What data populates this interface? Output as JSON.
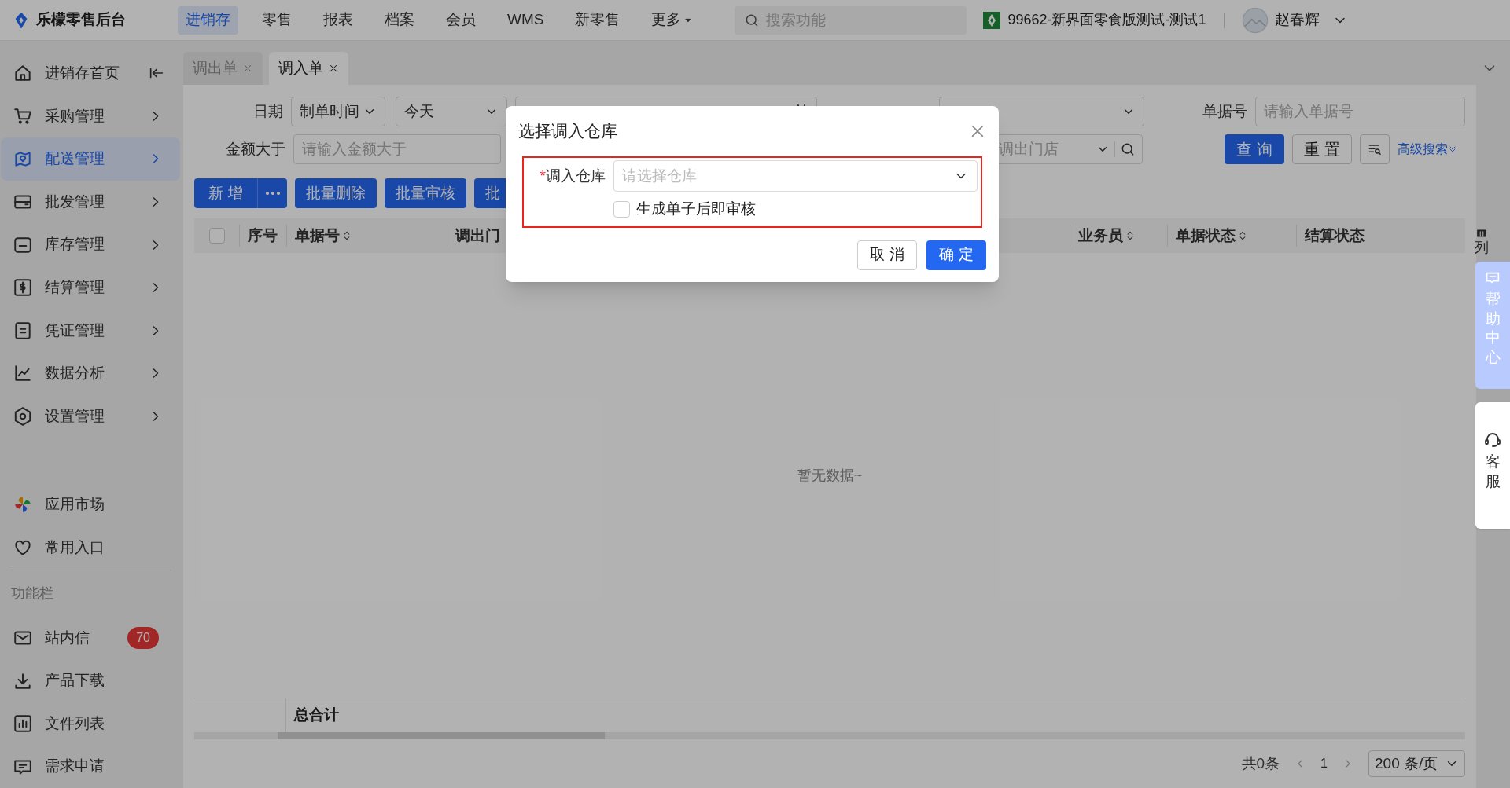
{
  "header": {
    "logo": "乐檬零售后台",
    "nav": [
      {
        "label": "进销存",
        "selected": true
      },
      {
        "label": "零售",
        "selected": false
      },
      {
        "label": "报表",
        "selected": false
      },
      {
        "label": "档案",
        "selected": false
      },
      {
        "label": "会员",
        "selected": false
      },
      {
        "label": "WMS",
        "selected": false
      },
      {
        "label": "新零售",
        "selected": false
      },
      {
        "label": "更多",
        "selected": false,
        "kind": "dropdown"
      }
    ],
    "search": {
      "placeholder": "搜索功能"
    },
    "store": "99662-新界面零食版测试-测试1",
    "user": "赵春辉"
  },
  "sidebar": {
    "items": [
      {
        "label": "进销存首页",
        "selected": false,
        "kind": "collapse"
      },
      {
        "label": "采购管理",
        "selected": false,
        "kind": "menu"
      },
      {
        "label": "配送管理",
        "selected": true,
        "kind": "menu"
      },
      {
        "label": "批发管理",
        "selected": false,
        "kind": "menu"
      },
      {
        "label": "库存管理",
        "selected": false,
        "kind": "menu"
      },
      {
        "label": "结算管理",
        "selected": false,
        "kind": "menu"
      },
      {
        "label": "凭证管理",
        "selected": false,
        "kind": "menu"
      },
      {
        "label": "数据分析",
        "selected": false,
        "kind": "menu"
      },
      {
        "label": "设置管理",
        "selected": false,
        "kind": "menu"
      }
    ],
    "extras": [
      {
        "label": "应用市场"
      },
      {
        "label": "常用入口"
      }
    ],
    "section_title": "功能栏",
    "tools": [
      {
        "label": "站内信",
        "badge": "70"
      },
      {
        "label": "产品下载"
      },
      {
        "label": "文件列表"
      },
      {
        "label": "需求申请"
      }
    ]
  },
  "tabs": [
    {
      "label": "调出单",
      "selected": false
    },
    {
      "label": "调入单",
      "selected": true
    }
  ],
  "filters": {
    "date_label": "日期",
    "date_type": "制单时间",
    "date_range": "今天",
    "doc_no_label": "单据号",
    "doc_no_placeholder": "请输入单据号",
    "amount_label": "金额大于",
    "amount_placeholder": "请输入金额大于",
    "store_placeholder": "调出门店",
    "query": "查 询",
    "reset": "重 置",
    "advanced": "高级搜索"
  },
  "actions": [
    "新 增",
    "批量删除",
    "批量审核",
    "批"
  ],
  "table": {
    "columns": [
      {
        "label": "序号",
        "sortable": false
      },
      {
        "label": "单据号",
        "sortable": true
      },
      {
        "label": "调出门",
        "sortable": false
      },
      {
        "label": "业务员",
        "sortable": true
      },
      {
        "label": "单据状态",
        "sortable": true
      },
      {
        "label": "结算状态",
        "sortable": false
      }
    ],
    "select_all_checked": false,
    "column_settings": "列",
    "empty": "暂无数据~",
    "total_label": "总合计"
  },
  "pagination": {
    "total": "共0条",
    "page": "1",
    "page_size": "200 条/页"
  },
  "float": {
    "help": "帮助中心",
    "service": "客服"
  },
  "dialog": {
    "title": "选择调入仓库",
    "field_label": "调入仓库",
    "required_mark": "*",
    "placeholder": "请选择仓库",
    "checkbox": {
      "label": "生成单子后即审核",
      "checked": false
    },
    "cancel": "取 消",
    "confirm": "确 定"
  }
}
